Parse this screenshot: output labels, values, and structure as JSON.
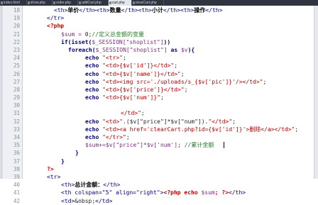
{
  "tabs": [
    {
      "label": "index.html"
    },
    {
      "label": "show.php"
    },
    {
      "label": "order.php"
    },
    {
      "label": "addCart.php"
    },
    {
      "label": "cart.php",
      "active": true
    },
    {
      "label": "clearCart.php"
    }
  ],
  "line_numbers": [
    "18",
    "19",
    "20",
    "21",
    "22",
    "23",
    "24",
    "25",
    "26",
    "27",
    "28",
    "29",
    "30",
    "31",
    "32",
    "33",
    "34",
    "35",
    "36",
    "37",
    "38",
    "39",
    "40",
    "41",
    "42"
  ],
  "code": {
    "l18": {
      "a": "<th>",
      "b": "单价",
      "c": "</th><th>",
      "d": "数量",
      "e": "</th><th>",
      "f": "小计",
      "g": "</th><th>",
      "h": "操作",
      "i": "</th>"
    },
    "l19": {
      "a": "</tr>"
    },
    "l20": {
      "a": "<?php"
    },
    "l21": {
      "a": "$sum = ",
      "b": "0",
      "c": ";",
      "d": "//定义总金额的变量"
    },
    "l22": {
      "a": "if",
      "b": "(isset(",
      "c": "$_SESSION[\"shoplist\"]",
      "d": "))"
    },
    "l23": {
      "a": "foreach",
      "b": "(",
      "c": "$_SESSION[\"shoplist\"]",
      "d": " as ",
      "e": "$v",
      "f": "){"
    },
    "l24": {
      "a": "echo ",
      "b": "\"<tr>\"",
      "c": ";"
    },
    "l25": {
      "a": "echo ",
      "b": "\"<td>{$v['id']}</td>\"",
      "c": ";"
    },
    "l26": {
      "a": "echo ",
      "b": "\"<td>{$v['name']}</td>\"",
      "c": ";"
    },
    "l27": {
      "a": "echo ",
      "b": "\"<td><img src='./uploads/s_{$v['pic']}'/></td>\"",
      "c": ";"
    },
    "l28": {
      "a": "echo ",
      "b": "\"<td>{$v['price']}</td>\"",
      "c": ";"
    },
    "l29": {
      "a": "echo ",
      "b": "\"<td>{$v['num']}\"",
      "c": ";"
    },
    "l30": {
      "a": ""
    },
    "l31": {
      "a": "</td>\"",
      "b": ";"
    },
    "l32": {
      "a": "echo ",
      "b": "\"<td>\"",
      "c": ".($v[\"price\"]*$v[\"num\"]).",
      "d": "\"</td>\"",
      "e": ";"
    },
    "l33": {
      "a": "echo ",
      "b": "\"<td><a href='clearCart.php?id={$v['id']}'>",
      "c": "删除",
      "d": "</a></td>\"",
      "e": ";"
    },
    "l34": {
      "a": "echo ",
      "b": "\"</tr>\"",
      "c": ";"
    },
    "l35": {
      "a": "$sum+=",
      "b": "$v[\"price\"]*$v['num']",
      "c": "; ",
      "d": "//累计金额"
    },
    "l36": {
      "a": "}"
    },
    "l37": {
      "a": "}"
    },
    "l38": {
      "a": "?>"
    },
    "l39": {
      "a": "<tr>"
    },
    "l40": {
      "a": "<th>",
      "b": "总计金额：",
      "c": "</th>"
    },
    "l41": {
      "a": "<th colspan=\"5\" align=\"right\">",
      "b": "<?php echo ",
      "c": "$sum",
      "d": "; ?>",
      "e": "</th>"
    },
    "l42": {
      "a": "<td>",
      "b": "&nbsp;",
      "c": "</td>"
    }
  }
}
